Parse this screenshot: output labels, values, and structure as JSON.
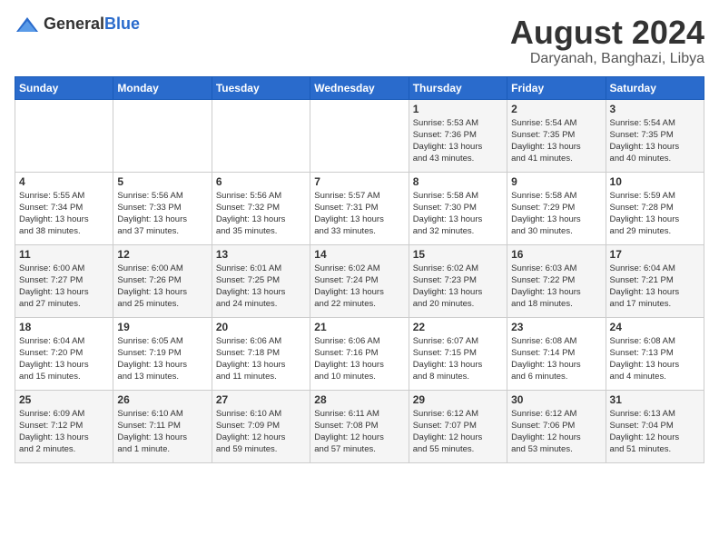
{
  "header": {
    "logo_general": "General",
    "logo_blue": "Blue",
    "month_year": "August 2024",
    "location": "Daryanah, Banghazi, Libya"
  },
  "weekdays": [
    "Sunday",
    "Monday",
    "Tuesday",
    "Wednesday",
    "Thursday",
    "Friday",
    "Saturday"
  ],
  "weeks": [
    [
      {
        "day": "",
        "info": ""
      },
      {
        "day": "",
        "info": ""
      },
      {
        "day": "",
        "info": ""
      },
      {
        "day": "",
        "info": ""
      },
      {
        "day": "1",
        "info": "Sunrise: 5:53 AM\nSunset: 7:36 PM\nDaylight: 13 hours\nand 43 minutes."
      },
      {
        "day": "2",
        "info": "Sunrise: 5:54 AM\nSunset: 7:35 PM\nDaylight: 13 hours\nand 41 minutes."
      },
      {
        "day": "3",
        "info": "Sunrise: 5:54 AM\nSunset: 7:35 PM\nDaylight: 13 hours\nand 40 minutes."
      }
    ],
    [
      {
        "day": "4",
        "info": "Sunrise: 5:55 AM\nSunset: 7:34 PM\nDaylight: 13 hours\nand 38 minutes."
      },
      {
        "day": "5",
        "info": "Sunrise: 5:56 AM\nSunset: 7:33 PM\nDaylight: 13 hours\nand 37 minutes."
      },
      {
        "day": "6",
        "info": "Sunrise: 5:56 AM\nSunset: 7:32 PM\nDaylight: 13 hours\nand 35 minutes."
      },
      {
        "day": "7",
        "info": "Sunrise: 5:57 AM\nSunset: 7:31 PM\nDaylight: 13 hours\nand 33 minutes."
      },
      {
        "day": "8",
        "info": "Sunrise: 5:58 AM\nSunset: 7:30 PM\nDaylight: 13 hours\nand 32 minutes."
      },
      {
        "day": "9",
        "info": "Sunrise: 5:58 AM\nSunset: 7:29 PM\nDaylight: 13 hours\nand 30 minutes."
      },
      {
        "day": "10",
        "info": "Sunrise: 5:59 AM\nSunset: 7:28 PM\nDaylight: 13 hours\nand 29 minutes."
      }
    ],
    [
      {
        "day": "11",
        "info": "Sunrise: 6:00 AM\nSunset: 7:27 PM\nDaylight: 13 hours\nand 27 minutes."
      },
      {
        "day": "12",
        "info": "Sunrise: 6:00 AM\nSunset: 7:26 PM\nDaylight: 13 hours\nand 25 minutes."
      },
      {
        "day": "13",
        "info": "Sunrise: 6:01 AM\nSunset: 7:25 PM\nDaylight: 13 hours\nand 24 minutes."
      },
      {
        "day": "14",
        "info": "Sunrise: 6:02 AM\nSunset: 7:24 PM\nDaylight: 13 hours\nand 22 minutes."
      },
      {
        "day": "15",
        "info": "Sunrise: 6:02 AM\nSunset: 7:23 PM\nDaylight: 13 hours\nand 20 minutes."
      },
      {
        "day": "16",
        "info": "Sunrise: 6:03 AM\nSunset: 7:22 PM\nDaylight: 13 hours\nand 18 minutes."
      },
      {
        "day": "17",
        "info": "Sunrise: 6:04 AM\nSunset: 7:21 PM\nDaylight: 13 hours\nand 17 minutes."
      }
    ],
    [
      {
        "day": "18",
        "info": "Sunrise: 6:04 AM\nSunset: 7:20 PM\nDaylight: 13 hours\nand 15 minutes."
      },
      {
        "day": "19",
        "info": "Sunrise: 6:05 AM\nSunset: 7:19 PM\nDaylight: 13 hours\nand 13 minutes."
      },
      {
        "day": "20",
        "info": "Sunrise: 6:06 AM\nSunset: 7:18 PM\nDaylight: 13 hours\nand 11 minutes."
      },
      {
        "day": "21",
        "info": "Sunrise: 6:06 AM\nSunset: 7:16 PM\nDaylight: 13 hours\nand 10 minutes."
      },
      {
        "day": "22",
        "info": "Sunrise: 6:07 AM\nSunset: 7:15 PM\nDaylight: 13 hours\nand 8 minutes."
      },
      {
        "day": "23",
        "info": "Sunrise: 6:08 AM\nSunset: 7:14 PM\nDaylight: 13 hours\nand 6 minutes."
      },
      {
        "day": "24",
        "info": "Sunrise: 6:08 AM\nSunset: 7:13 PM\nDaylight: 13 hours\nand 4 minutes."
      }
    ],
    [
      {
        "day": "25",
        "info": "Sunrise: 6:09 AM\nSunset: 7:12 PM\nDaylight: 13 hours\nand 2 minutes."
      },
      {
        "day": "26",
        "info": "Sunrise: 6:10 AM\nSunset: 7:11 PM\nDaylight: 13 hours\nand 1 minute."
      },
      {
        "day": "27",
        "info": "Sunrise: 6:10 AM\nSunset: 7:09 PM\nDaylight: 12 hours\nand 59 minutes."
      },
      {
        "day": "28",
        "info": "Sunrise: 6:11 AM\nSunset: 7:08 PM\nDaylight: 12 hours\nand 57 minutes."
      },
      {
        "day": "29",
        "info": "Sunrise: 6:12 AM\nSunset: 7:07 PM\nDaylight: 12 hours\nand 55 minutes."
      },
      {
        "day": "30",
        "info": "Sunrise: 6:12 AM\nSunset: 7:06 PM\nDaylight: 12 hours\nand 53 minutes."
      },
      {
        "day": "31",
        "info": "Sunrise: 6:13 AM\nSunset: 7:04 PM\nDaylight: 12 hours\nand 51 minutes."
      }
    ]
  ]
}
